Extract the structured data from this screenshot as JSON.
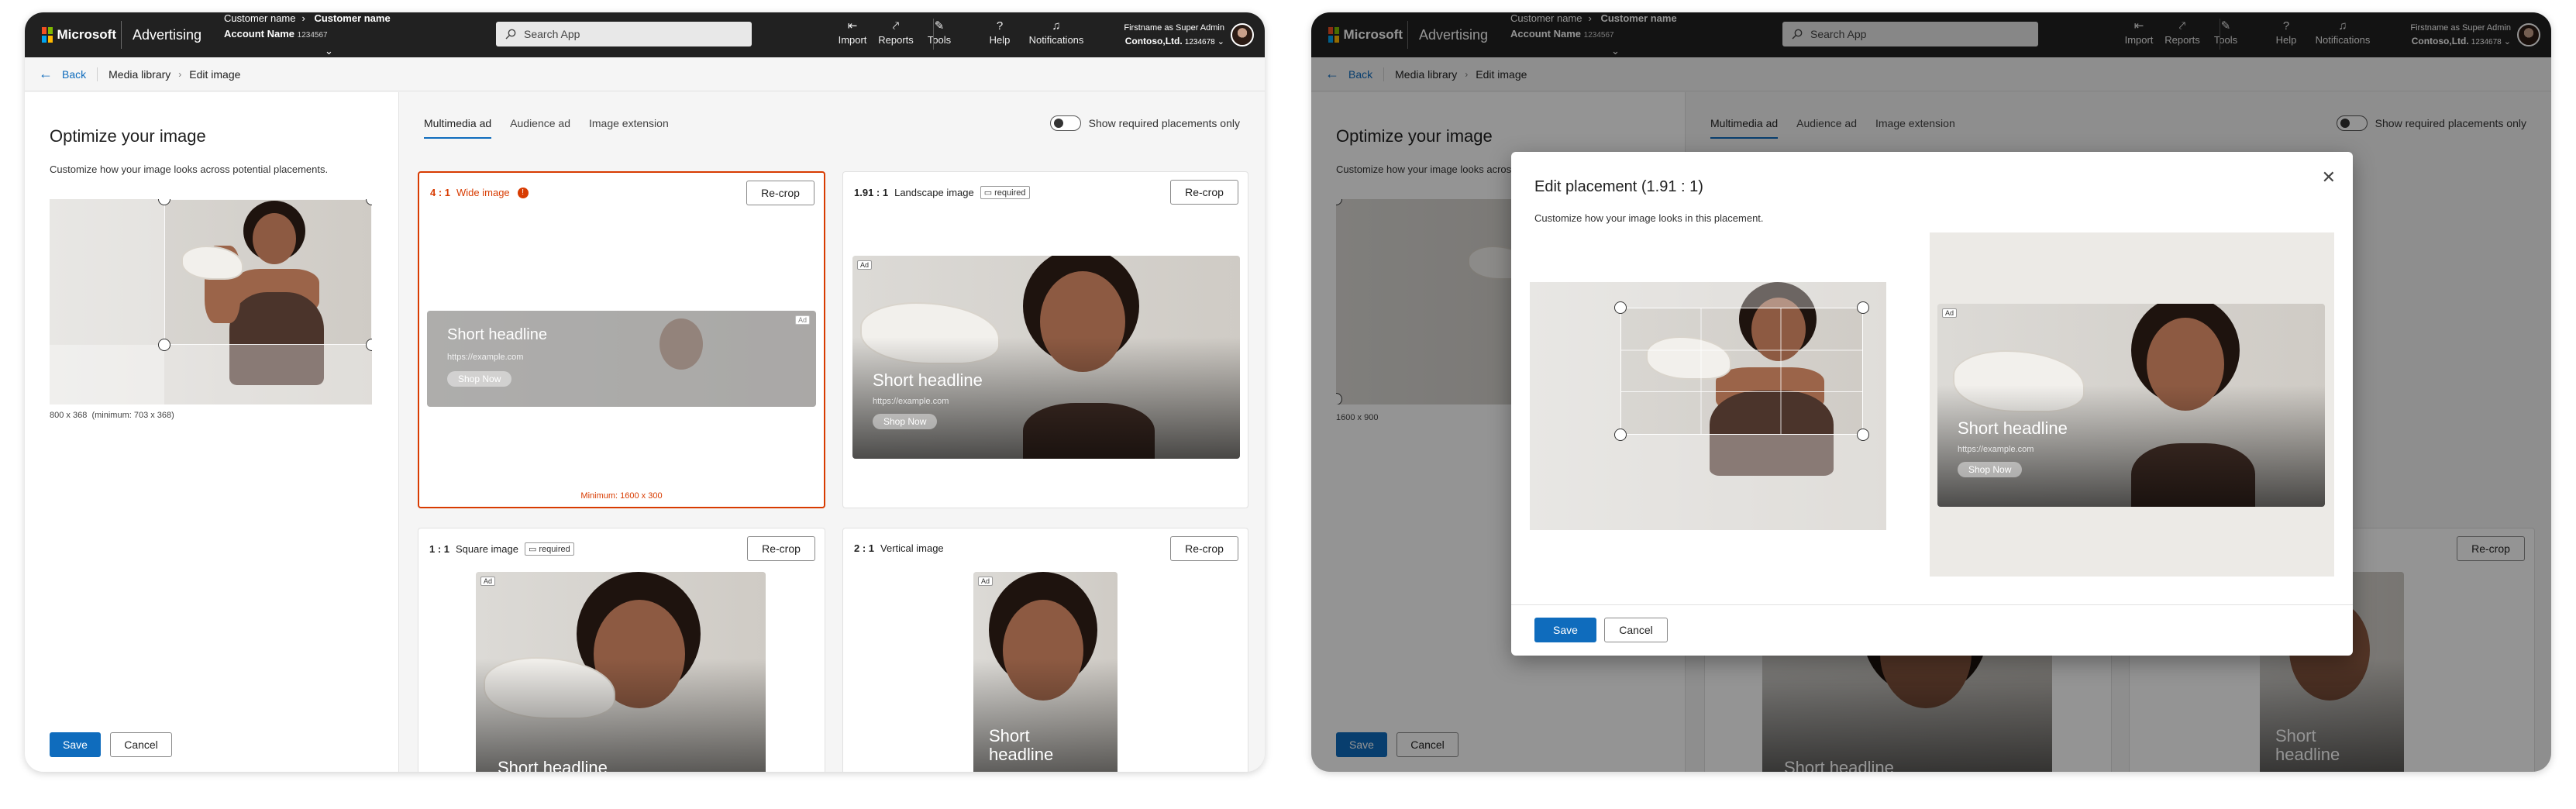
{
  "topbar": {
    "logo_text": "Microsoft",
    "brand": "Advertising",
    "customer_label": "Customer name",
    "customer_value": "Customer name",
    "account_label": "Account Name",
    "account_id": "1234567",
    "search_placeholder": "Search App",
    "nav": [
      {
        "label": "Import",
        "icon": "import-icon"
      },
      {
        "label": "Reports",
        "icon": "reports-icon"
      },
      {
        "label": "Tools",
        "icon": "tools-icon"
      },
      {
        "label": "Help",
        "icon": "help-icon"
      },
      {
        "label": "Notifications",
        "icon": "bell-icon"
      }
    ],
    "user_role": "Firstname as Super Admin",
    "user_company": "Contoso,Ltd.",
    "user_id": "1234678"
  },
  "breadcrumb": {
    "back": "Back",
    "items": [
      "Media library",
      "Edit image"
    ]
  },
  "left": {
    "title": "Optimize your image",
    "description": "Customize how your image looks across potential placements.",
    "dims_main": "800 x 368",
    "dims_min": "(minimum: 703 x 368)",
    "dims_s2": "1600 x 900",
    "save": "Save",
    "cancel": "Cancel"
  },
  "tabs": [
    "Multimedia ad",
    "Audience ad",
    "Image extension"
  ],
  "toggle_label": "Show required placements only",
  "cards": [
    {
      "ratio": "4 : 1",
      "name": "Wide image",
      "required": false,
      "error": true,
      "minimum": "Minimum: 1600 x 300"
    },
    {
      "ratio": "1.91 : 1",
      "name": "Landscape image",
      "required": true,
      "error": false
    },
    {
      "ratio": "1 : 1",
      "name": "Square image",
      "required": true,
      "error": false
    },
    {
      "ratio": "2 : 1",
      "name": "Vertical image",
      "required": false,
      "error": false
    }
  ],
  "recrop": "Re-crop",
  "required_label": "required",
  "ad": {
    "tag": "Ad",
    "headline": "Short headline",
    "url": "https://example.com",
    "cta": "Shop Now"
  },
  "dialog": {
    "title": "Edit placement (1.91 : 1)",
    "description": "Customize how your image looks in this placement.",
    "save": "Save",
    "cancel": "Cancel"
  },
  "colors": {
    "accent": "#0f6cbd",
    "error": "#d83b01",
    "topbar": "#212121"
  }
}
